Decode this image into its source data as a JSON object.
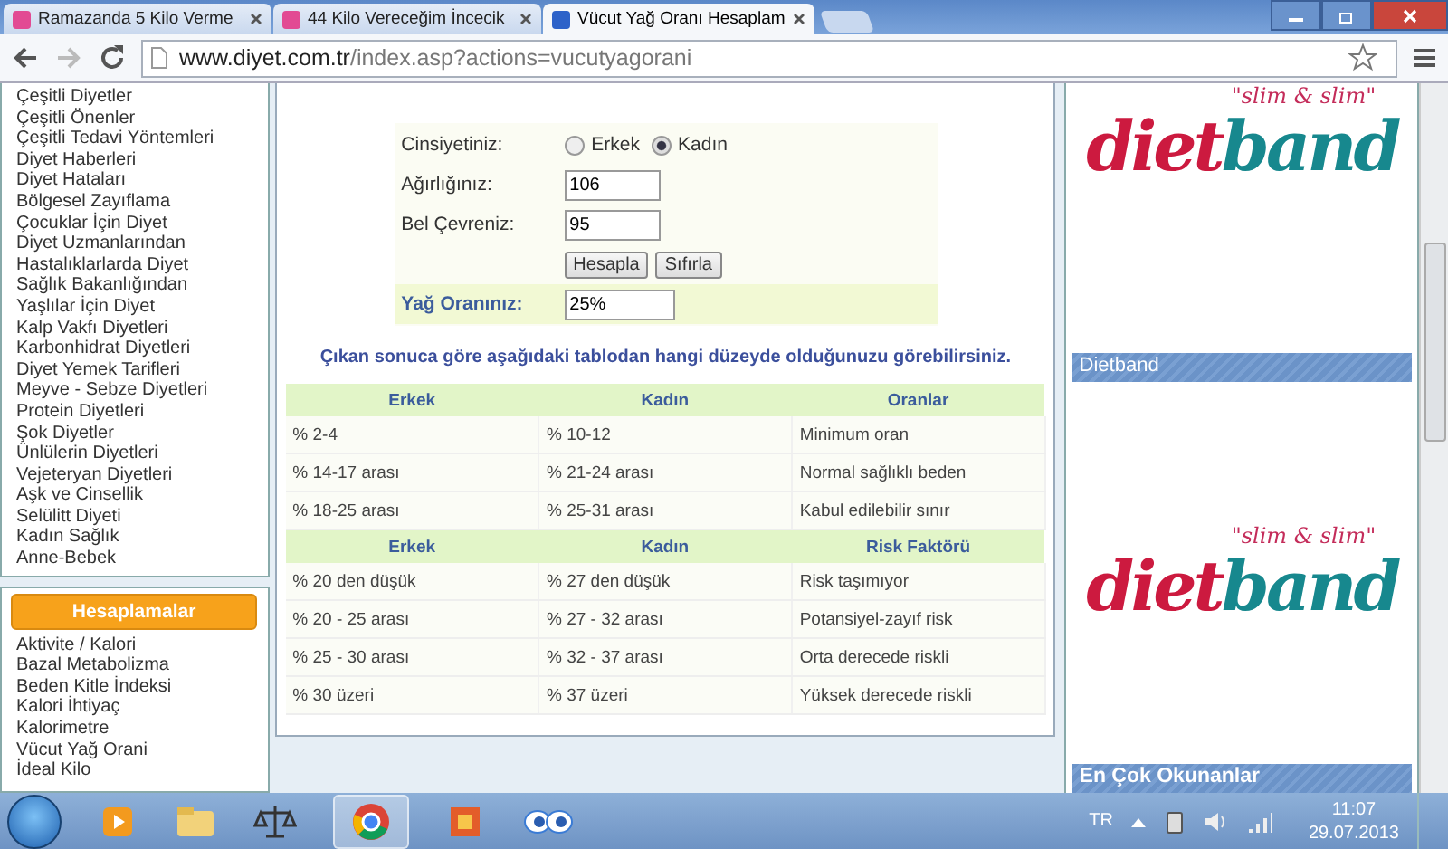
{
  "tabs": [
    {
      "title": "Ramazanda 5 Kilo Verme",
      "selected": false
    },
    {
      "title": "44 Kilo Vereceğim İncecik",
      "selected": false
    },
    {
      "title": "Vücut Yağ Oranı Hesaplam",
      "selected": true
    }
  ],
  "address": {
    "domain": "www.diyet.com.tr",
    "path": "/index.asp?actions=vucutyagorani"
  },
  "sidebar": {
    "menu": [
      "Çeşitli Diyetler",
      "Çeşitli Önenler",
      "Çeşitli Tedavi Yöntemleri",
      "Diyet Haberleri",
      "Diyet Hataları",
      "Bölgesel Zayıflama",
      "Çocuklar İçin Diyet",
      "Diyet Uzmanlarından",
      "Hastalıklarlarda Diyet",
      "Sağlık Bakanlığından",
      "Yaşlılar İçin Diyet",
      "Kalp Vakfı Diyetleri",
      "Karbonhidrat Diyetleri",
      "Diyet Yemek Tarifleri",
      "Meyve - Sebze Diyetleri",
      "Protein Diyetleri",
      "Şok Diyetler",
      "Ünlülerin Diyetleri",
      "Vejeteryan Diyetleri",
      "Aşk ve Cinsellik",
      "Selülitt Diyeti",
      "Kadın Sağlık",
      "Anne-Bebek"
    ],
    "calc_header": "Hesaplamalar",
    "calc_items": [
      "Aktivite / Kalori",
      "Bazal Metabolizma",
      "Beden Kitle İndeksi",
      "Kalori İhtiyaç",
      "Kalorimetre",
      "Vücut Yağ Orani",
      "İdeal Kilo"
    ]
  },
  "form": {
    "gender_label": "Cinsiyetiniz:",
    "genders": [
      {
        "label": "Erkek",
        "selected": false
      },
      {
        "label": "Kadın",
        "selected": true
      }
    ],
    "weight_label": "Ağırlığınız:",
    "weight": "106",
    "waist_label": "Bel Çevreniz:",
    "waist": "95",
    "buttons": [
      "Hesapla",
      "Sıfırla"
    ],
    "result_label": "Yağ Oranınız:",
    "result": "25%"
  },
  "note": "Çıkan sonuca göre aşağıdaki tablodan hangi düzeyde olduğunuzu görebilirsiniz.",
  "tables": [
    {
      "columns": [
        "Erkek",
        "Kadın",
        "Oranlar"
      ],
      "rows": [
        [
          "% 2-4",
          "% 10-12",
          "Minimum oran"
        ],
        [
          "% 14-17 arası",
          "% 21-24 arası",
          "Normal sağlıklı beden"
        ],
        [
          "% 18-25 arası",
          "% 25-31 arası",
          "Kabul edilebilir sınır"
        ]
      ]
    },
    {
      "columns": [
        "Erkek",
        "Kadın",
        "Risk Faktörü"
      ],
      "rows": [
        [
          "% 20 den düşük",
          "% 27 den düşük",
          "Risk taşımıyor"
        ],
        [
          "% 20 - 25 arası",
          "% 27 - 32 arası",
          "Potansiyel-zayıf risk"
        ],
        [
          "% 25 - 30 arası",
          "% 32 - 37 arası",
          "Orta derecede riskli"
        ],
        [
          "% 30 üzeri",
          "% 37 üzeri",
          "Yüksek derecede riskli"
        ]
      ]
    }
  ],
  "right": {
    "ads": [
      {
        "tagline": "\"slim & slim\"",
        "logo_a": "diet",
        "logo_b": "band"
      },
      {
        "tagline": "\"slim & slim\"",
        "logo_a": "diet",
        "logo_b": "band"
      }
    ],
    "section_titles": [
      "Dietband",
      "En Çok Okunanlar"
    ]
  },
  "taskbar": {
    "language": "TR",
    "time": "11:07",
    "date": "29.07.2013"
  }
}
